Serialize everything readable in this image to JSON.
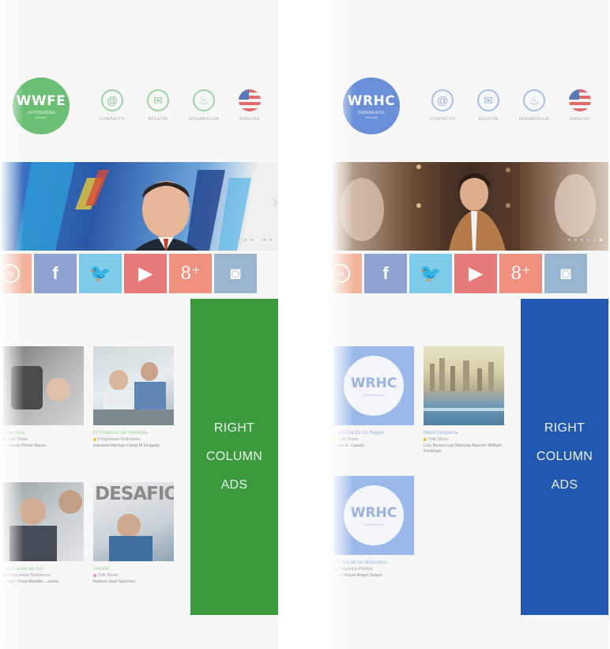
{
  "panels": {
    "left": {
      "logo": {
        "mark": "WWFE",
        "sub": "LA PODEROSA",
        "sub2": "670 AM"
      },
      "nav": [
        {
          "label": "CONTACTO",
          "icon": "at-icon"
        },
        {
          "label": "BOLETIN",
          "icon": "mail-icon"
        },
        {
          "label": "HOGAR/CLUB",
          "icon": "food-icon"
        },
        {
          "label": "ENGLISH",
          "icon": "flag-icon"
        }
      ],
      "social": [
        "radio-icon",
        "facebook-icon",
        "twitter-icon",
        "youtube-icon",
        "googleplus-icon",
        "instagram-icon"
      ],
      "ads": "RIGHT\nCOLUMN\nADS",
      "cards": [
        {
          "title": "...ine Nota",
          "category": "Talk Show",
          "author": "...rnando Perez Roura"
        },
        {
          "title": "El Poderoso del Mediodía",
          "category": "Programas Noticiosos",
          "author": "Eduardo Aleman-Lieria M.Delgado"
        },
        {
          "title": "...la Capital del Sol",
          "category": "Programas Noticiosos",
          "author": "...oger Vivas-Marlela ...arries"
        },
        {
          "title": "Desafio",
          "category": "Talk Show",
          "author": "Ramon Saul Sanchez"
        }
      ],
      "desafio_text": "DESAFIO",
      "colors": {
        "accent": "#6bbf74",
        "ads": "#3a9a3c"
      }
    },
    "right": {
      "logo": {
        "mark": "WRHC",
        "sub": "CADENA AZUL",
        "sub2": "1550 AM"
      },
      "nav": [
        {
          "label": "CONTACTO",
          "icon": "at-icon"
        },
        {
          "label": "BOLETIN",
          "icon": "mail-icon"
        },
        {
          "label": "HOGAR/CLUB",
          "icon": "food-icon"
        },
        {
          "label": "ENGLISH",
          "icon": "flag-icon"
        }
      ],
      "social": [
        "radio-icon",
        "facebook-icon",
        "twitter-icon",
        "youtube-icon",
        "googleplus-icon",
        "instagram-icon"
      ],
      "ads": "RIGHT\nCOLUMN\nADS",
      "cards": [
        {
          "title": "...ada Dia Es Un Regalo",
          "category": "Talk Show",
          "author": "...aria A. Casulo",
          "logo": "WRHC",
          "logo_sub": "CADENA AZUL"
        },
        {
          "title": "Miami Despierta",
          "category": "Talk Show",
          "author": "Luis Betancourt-Marcela Alarcón-William Restrepo"
        },
        {
          "title": "...a Voz de los Municipios",
          "category": "Programa Politica",
          "author": "...an Miguel Angel Solaris",
          "logo": "WRHC",
          "logo_sub": "CADENA AZUL"
        }
      ],
      "colors": {
        "accent": "#6a8fd8",
        "ads": "#2358b2"
      }
    }
  }
}
